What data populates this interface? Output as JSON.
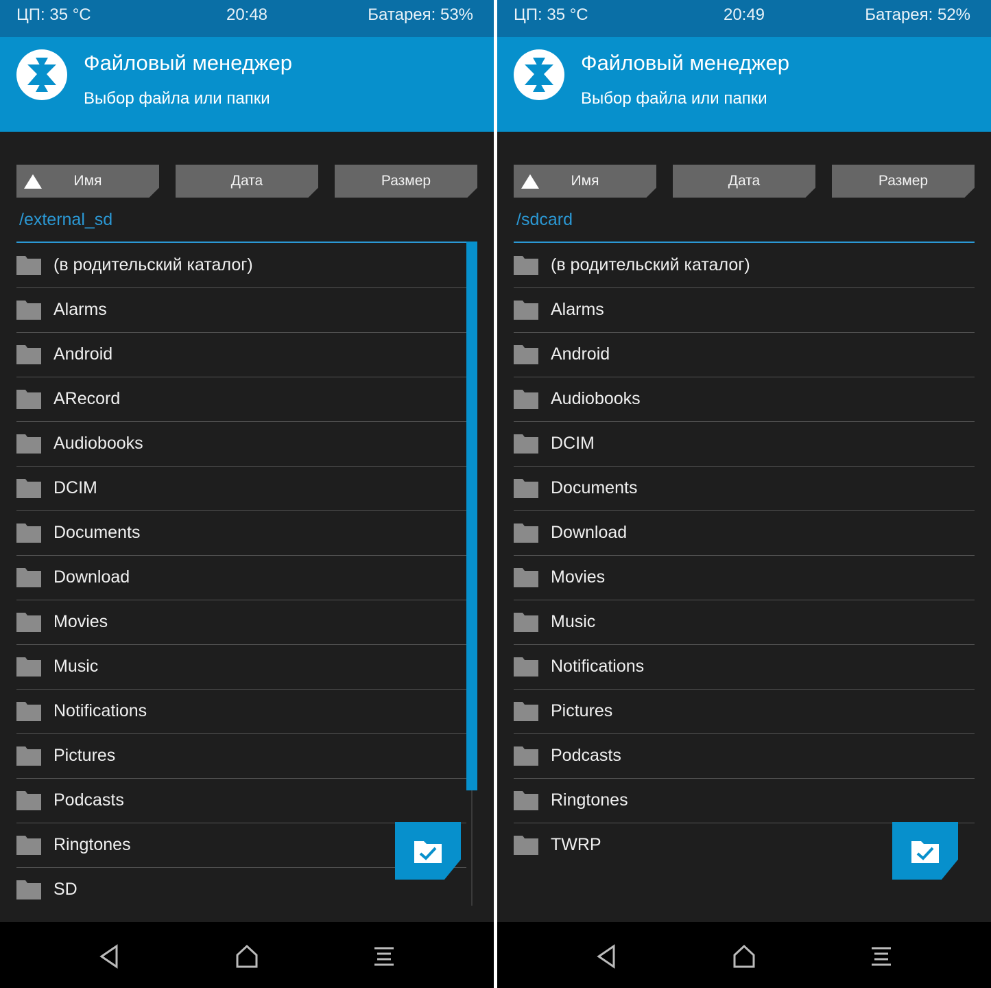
{
  "panels": [
    {
      "status": {
        "cpu": "ЦП: 35 °C",
        "time": "20:48",
        "battery": "Батарея: 53%"
      },
      "header": {
        "title": "Файловый менеджер",
        "subtitle": "Выбор файла или папки"
      },
      "sort": {
        "name": "Имя",
        "date": "Дата",
        "size": "Размер"
      },
      "path": "/external_sd",
      "items": [
        "(в родительский каталог)",
        "Alarms",
        "Android",
        "ARecord",
        "Audiobooks",
        "DCIM",
        "Documents",
        "Download",
        "Movies",
        "Music",
        "Notifications",
        "Pictures",
        "Podcasts",
        "Ringtones",
        "SD"
      ],
      "has_scrollbar": true
    },
    {
      "status": {
        "cpu": "ЦП: 35 °C",
        "time": "20:49",
        "battery": "Батарея: 52%"
      },
      "header": {
        "title": "Файловый менеджер",
        "subtitle": "Выбор файла или папки"
      },
      "sort": {
        "name": "Имя",
        "date": "Дата",
        "size": "Размер"
      },
      "path": "/sdcard",
      "items": [
        "(в родительский каталог)",
        "Alarms",
        "Android",
        "Audiobooks",
        "DCIM",
        "Documents",
        "Download",
        "Movies",
        "Music",
        "Notifications",
        "Pictures",
        "Podcasts",
        "Ringtones",
        "TWRP"
      ],
      "has_scrollbar": false
    }
  ],
  "icons": {
    "folder": "folder-icon",
    "sort_direction": "sort-ascending-icon",
    "fab": "select-folder-icon",
    "nav": [
      "back-icon",
      "home-icon",
      "menu-icon"
    ]
  },
  "colors": {
    "accent": "#0790cc",
    "statusbar": "#0a6fa6",
    "background": "#1e1e1e",
    "button": "#666666",
    "path": "#2b98d4"
  }
}
